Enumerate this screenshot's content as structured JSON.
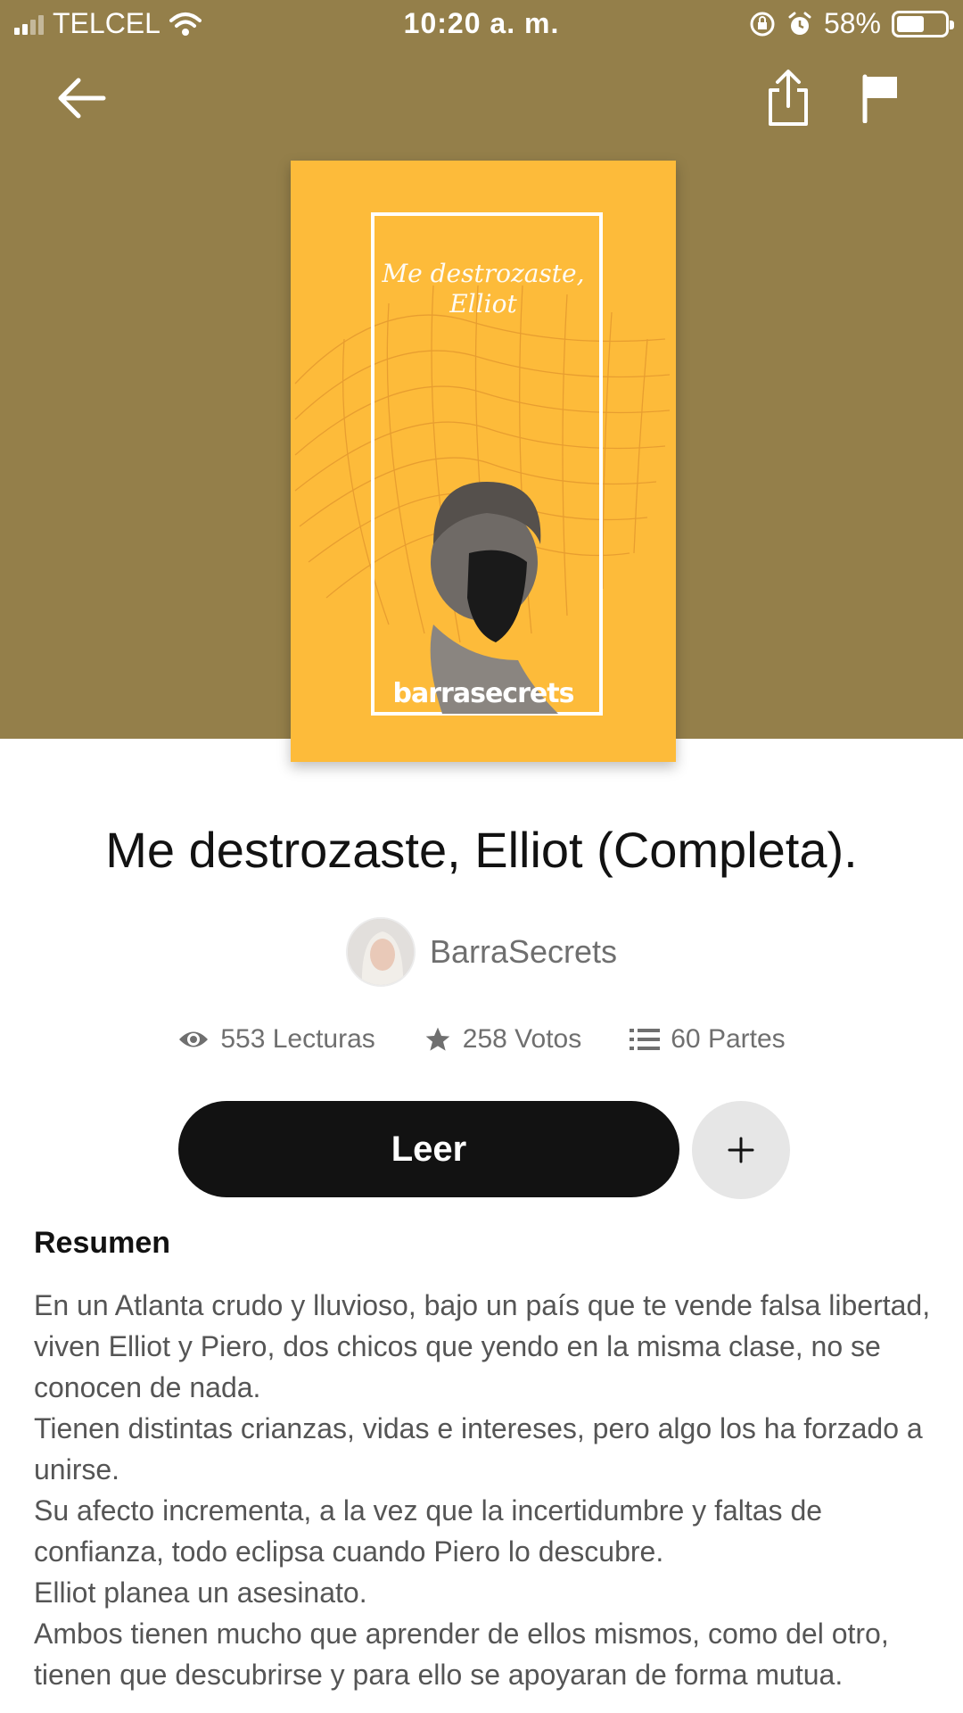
{
  "status_bar": {
    "carrier": "TELCEL",
    "time": "10:20 a. m.",
    "battery": "58%",
    "battery_level": 0.58
  },
  "nav": {
    "back_icon": "arrow-left-icon",
    "share_icon": "share-icon",
    "report_icon": "flag-icon"
  },
  "cover": {
    "title_line1": "Me destrozaste,",
    "title_line2": "Elliot",
    "brand": "barrasecrets",
    "background_color": "#fdbb3a"
  },
  "story": {
    "title": "Me destrozaste, Elliot (Completa).",
    "author": "BarraSecrets"
  },
  "stats": {
    "reads": "553 Lecturas",
    "votes": "258 Votos",
    "parts": "60 Partes"
  },
  "actions": {
    "read_label": "Leer",
    "add_label": "+"
  },
  "summary": {
    "heading": "Resumen",
    "paragraphs": [
      "En un Atlanta crudo y lluvioso, bajo un país que te vende falsa libertad, viven Elliot y Piero, dos chicos que yendo en la misma clase, no se conocen de nada.",
      "Tienen distintas crianzas, vidas e intereses, pero algo los ha forzado a unirse.",
      "Su afecto incrementa, a la vez que la incertidumbre y faltas de confianza, todo eclipsa cuando Piero lo descubre.",
      "Elliot planea un asesinato.",
      "Ambos tienen mucho que aprender de ellos mismos, como del otro, tienen que descubrirse y para ello se apoyaran de forma mutua."
    ]
  },
  "colors": {
    "header": "#947f4a",
    "button": "#121212",
    "accent_cover": "#fdbb3a"
  }
}
